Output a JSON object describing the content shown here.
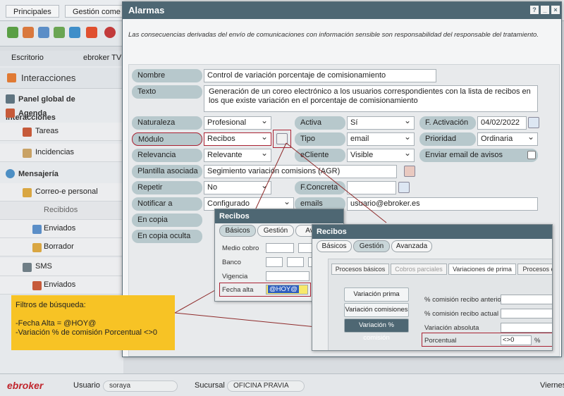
{
  "app": {
    "menu": [
      "Principales",
      "Gestión come"
    ],
    "tabs": [
      "Escritorio",
      "ebroker TV"
    ],
    "sidebar": {
      "section": "Interacciones",
      "items": [
        {
          "label": "Panel global de interacciones",
          "bold": true
        },
        {
          "label": "Agenda",
          "bold": true
        },
        {
          "label": "Tareas",
          "bold": false
        },
        {
          "label": "Incidencias",
          "bold": false
        },
        {
          "label": "Mensajería",
          "bold": true
        },
        {
          "label": "Correo-e personal",
          "bold": false
        },
        {
          "label": "Recibidos",
          "bold": false
        },
        {
          "label": "Enviados",
          "bold": false
        },
        {
          "label": "Borrador",
          "bold": false
        },
        {
          "label": "SMS",
          "bold": false
        },
        {
          "label": "Enviados",
          "bold": false
        }
      ]
    },
    "status": {
      "logo": "ebroker",
      "usuario_label": "Usuario",
      "usuario_value": "soraya",
      "sucursal_label": "Sucursal",
      "sucursal_value": "OFICINA PRAVIA",
      "day": "Viernes"
    }
  },
  "dialog": {
    "title": "Alarmas",
    "window_buttons": [
      "?",
      "_",
      "×"
    ],
    "notice": "Las consecuencias derivadas del envío de comunicaciones con información sensible son responsabilidad del responsable del tratamiento.",
    "fields": {
      "nombre": {
        "label": "Nombre",
        "value": "Control de variación porcentaje de comisionamiento"
      },
      "texto": {
        "label": "Texto",
        "value": "Generación de un coreo electrónico a los usuarios correspondientes con la lista de recibos en los que existe variación en el porcentaje de comisionamiento"
      },
      "naturaleza": {
        "label": "Naturaleza",
        "value": "Profesional"
      },
      "activa": {
        "label": "Activa",
        "value": "Sí"
      },
      "f_activacion": {
        "label": "F. Activación",
        "value": "04/02/2022"
      },
      "modulo": {
        "label": "Módulo",
        "value": "Recibos"
      },
      "tipo": {
        "label": "Tipo",
        "value": "email"
      },
      "prioridad": {
        "label": "Prioridad",
        "value": "Ordinaria"
      },
      "relevancia": {
        "label": "Relevancia",
        "value": "Relevante"
      },
      "ecliente": {
        "label": "eCliente",
        "value": "Visible"
      },
      "enviar_avisos": {
        "label": "Enviar email de avisos"
      },
      "plantilla": {
        "label": "Plantilla asociada",
        "value": "Segimiento variación comisions (AGR)"
      },
      "repetir": {
        "label": "Repetir",
        "value": "No"
      },
      "f_concreta": {
        "label": "F.Concreta",
        "value": ""
      },
      "notificar": {
        "label": "Notificar a",
        "value": "Configurado"
      },
      "emails": {
        "label": "emails",
        "value": "usuario@ebroker.es"
      },
      "en_copia": {
        "label": "En copia"
      },
      "en_copia_oculta": {
        "label": "En copia oculta"
      }
    }
  },
  "recibos1": {
    "title": "Recibos",
    "tabs": [
      "Básicos",
      "Gestión",
      "Av"
    ],
    "fields": [
      "Medio cobro",
      "Banco",
      "Vigencia",
      "Fecha alta"
    ],
    "fecha_alta_value": "@HOY@"
  },
  "recibos2": {
    "title": "Recibos",
    "tabs": [
      "Básicos",
      "Gestión",
      "Avanzada"
    ],
    "subtabs": [
      "Procesos básicos",
      "Cobros parciales",
      "Variaciones de prima",
      "Procesos e"
    ],
    "side_buttons": [
      "Variación prima",
      "Variación comisiones",
      "Variación % comisión"
    ],
    "fields": [
      {
        "label": "% comisión recibo anterior",
        "value": ""
      },
      {
        "label": "% comisión recibo actual",
        "value": ""
      },
      {
        "label": "Variación absoluta",
        "value": ""
      },
      {
        "label": "Porcentual",
        "value": "<>0",
        "unit": "%"
      }
    ]
  },
  "note": {
    "title": "Filtros de  búsqueda:",
    "lines": [
      "-Fecha Alta = @HOY@",
      "-Variación % de comisión Porcentual <>0"
    ]
  },
  "colors": {
    "title_bar": "#4e6773",
    "label_pill": "#b7c8cc",
    "note_bg": "#f7c325",
    "highlight_border": "#a23"
  }
}
